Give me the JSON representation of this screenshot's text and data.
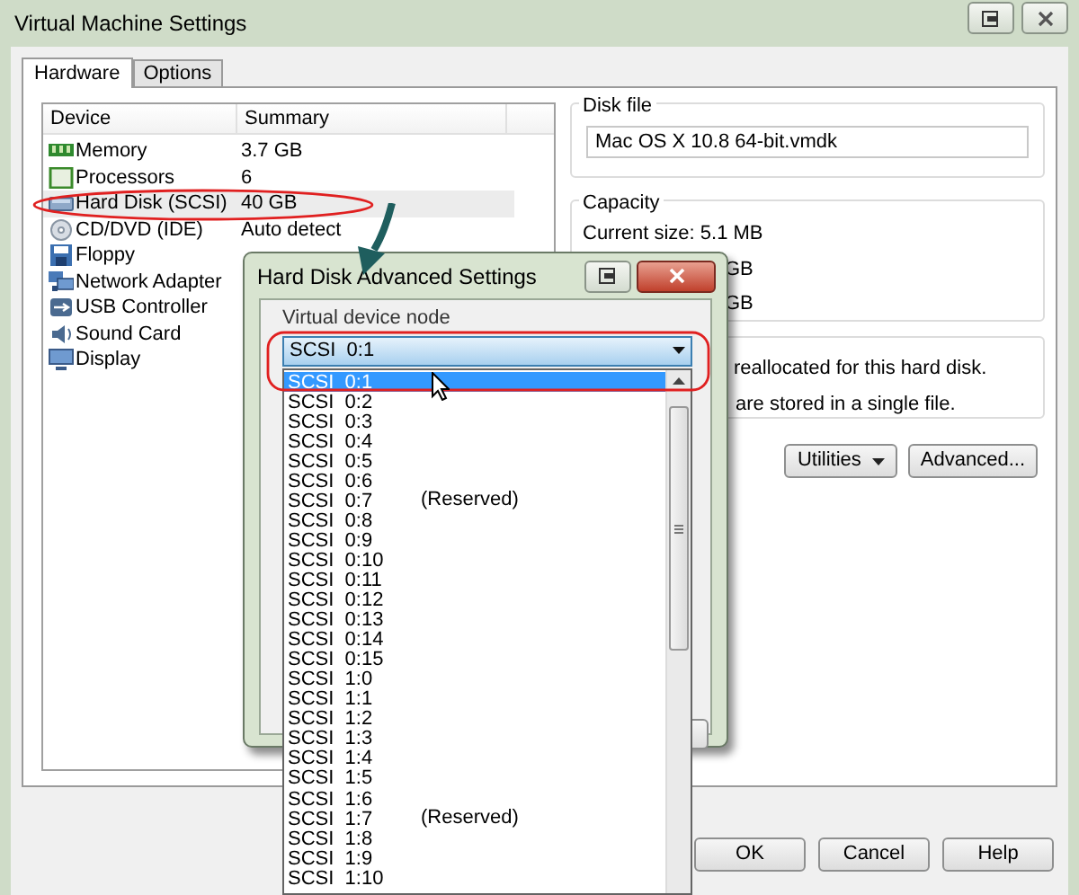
{
  "window": {
    "title": "Virtual Machine Settings"
  },
  "tabs": [
    {
      "label": "Hardware",
      "selected": true
    },
    {
      "label": "Options",
      "selected": false
    }
  ],
  "device_table": {
    "columns": [
      "Device",
      "Summary"
    ],
    "rows": [
      {
        "device": "Memory",
        "summary": "3.7 GB",
        "kind": "memory",
        "selected": false
      },
      {
        "device": "Processors",
        "summary": "6",
        "kind": "cpu",
        "selected": false
      },
      {
        "device": "Hard Disk (SCSI)",
        "summary": "40 GB",
        "kind": "disk",
        "selected": true
      },
      {
        "device": "CD/DVD (IDE)",
        "summary": "Auto detect",
        "kind": "cd",
        "selected": false
      },
      {
        "device": "Floppy",
        "kind": "floppy",
        "selected": false
      },
      {
        "device": "Network Adapter",
        "kind": "network",
        "selected": false
      },
      {
        "device": "USB Controller",
        "kind": "usb",
        "selected": false
      },
      {
        "device": "Sound Card",
        "kind": "sound",
        "selected": false
      },
      {
        "device": "Display",
        "kind": "display",
        "selected": false
      }
    ]
  },
  "disk_file": {
    "title": "Disk file",
    "value": "Mac OS X 10.8 64-bit.vmdk"
  },
  "capacity": {
    "title": "Capacity",
    "current": "Current size:  5.1 MB",
    "lines": [
      "GB",
      "GB"
    ]
  },
  "disk_info": {
    "lines": [
      "reallocated for this hard disk.",
      "are stored in a single file."
    ]
  },
  "actions": [
    {
      "label": "Utilities",
      "has_menu": true
    },
    {
      "label": "Advanced...",
      "has_menu": false
    }
  ],
  "footer_buttons": [
    "OK",
    "Cancel",
    "Help"
  ],
  "dialog": {
    "title": "Hard Disk Advanced Settings",
    "group_label": "Virtual device node",
    "combo": {
      "value": "SCSI  0:1"
    },
    "options": [
      {
        "label": "SCSI  0:1",
        "selected": true
      },
      {
        "label": "SCSI  0:2",
        "selected": false
      },
      {
        "label": "SCSI  0:3",
        "selected": false
      },
      {
        "label": "SCSI  0:4",
        "selected": false
      },
      {
        "label": "SCSI  0:5",
        "selected": false
      },
      {
        "label": "SCSI  0:6",
        "selected": false
      },
      {
        "label": "SCSI  0:7",
        "note": "(Reserved)",
        "selected": false
      },
      {
        "label": "SCSI  0:8",
        "selected": false
      },
      {
        "label": "SCSI  0:9",
        "selected": false
      },
      {
        "label": "SCSI  0:10",
        "selected": false
      },
      {
        "label": "SCSI  0:11",
        "selected": false
      },
      {
        "label": "SCSI  0:12",
        "selected": false
      },
      {
        "label": "SCSI  0:13",
        "selected": false
      },
      {
        "label": "SCSI  0:14",
        "selected": false
      },
      {
        "label": "SCSI  0:15",
        "selected": false
      },
      {
        "label": "SCSI  1:0",
        "selected": false
      },
      {
        "label": "SCSI  1:1",
        "selected": false
      },
      {
        "label": "SCSI  1:2",
        "selected": false
      },
      {
        "label": "SCSI  1:3",
        "selected": false
      },
      {
        "label": "SCSI  1:4",
        "selected": false
      },
      {
        "label": "SCSI  1:5",
        "selected": false
      },
      {
        "label": "SCSI  1:6",
        "selected": false
      },
      {
        "label": "SCSI  1:7",
        "note": "(Reserved)",
        "selected": false
      },
      {
        "label": "SCSI  1:8",
        "selected": false
      },
      {
        "label": "SCSI  1:9",
        "selected": false
      },
      {
        "label": "SCSI  1:10",
        "selected": false
      }
    ]
  }
}
